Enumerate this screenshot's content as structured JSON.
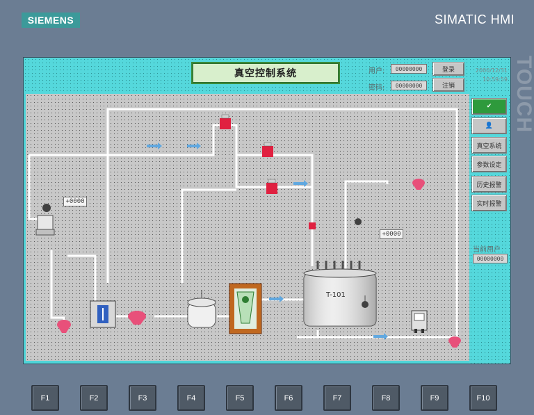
{
  "bezel": {
    "brand": "SIEMENS",
    "product": "SIMATIC HMI",
    "touch_label": "TOUCH"
  },
  "header": {
    "title": "真空控制系统",
    "user_label": "用户:",
    "user_value": "00000000",
    "password_label": "密码:",
    "password_value": "00000000",
    "login_button": "登录",
    "logout_button": "注销",
    "date": "2000/12/31",
    "time": "10:59:59"
  },
  "nav": {
    "items": [
      "真空系统",
      "参数设定",
      "历史报警",
      "实时报警"
    ],
    "current_user_label": "当前用户",
    "current_user_value": "00000000"
  },
  "process": {
    "tank_label": "T-101",
    "io_field_left": "+0000",
    "io_field_right": "+0000"
  },
  "fkeys": [
    "F1",
    "F2",
    "F3",
    "F4",
    "F5",
    "F6",
    "F7",
    "F8",
    "F9",
    "F10"
  ],
  "colors": {
    "screen_bg": "#4fd4d8",
    "process_bg": "#c8c8c8",
    "valve": "#e02040",
    "pump": "#e8507a",
    "pipe": "#ffffff",
    "title_border": "#3a8a3a"
  }
}
